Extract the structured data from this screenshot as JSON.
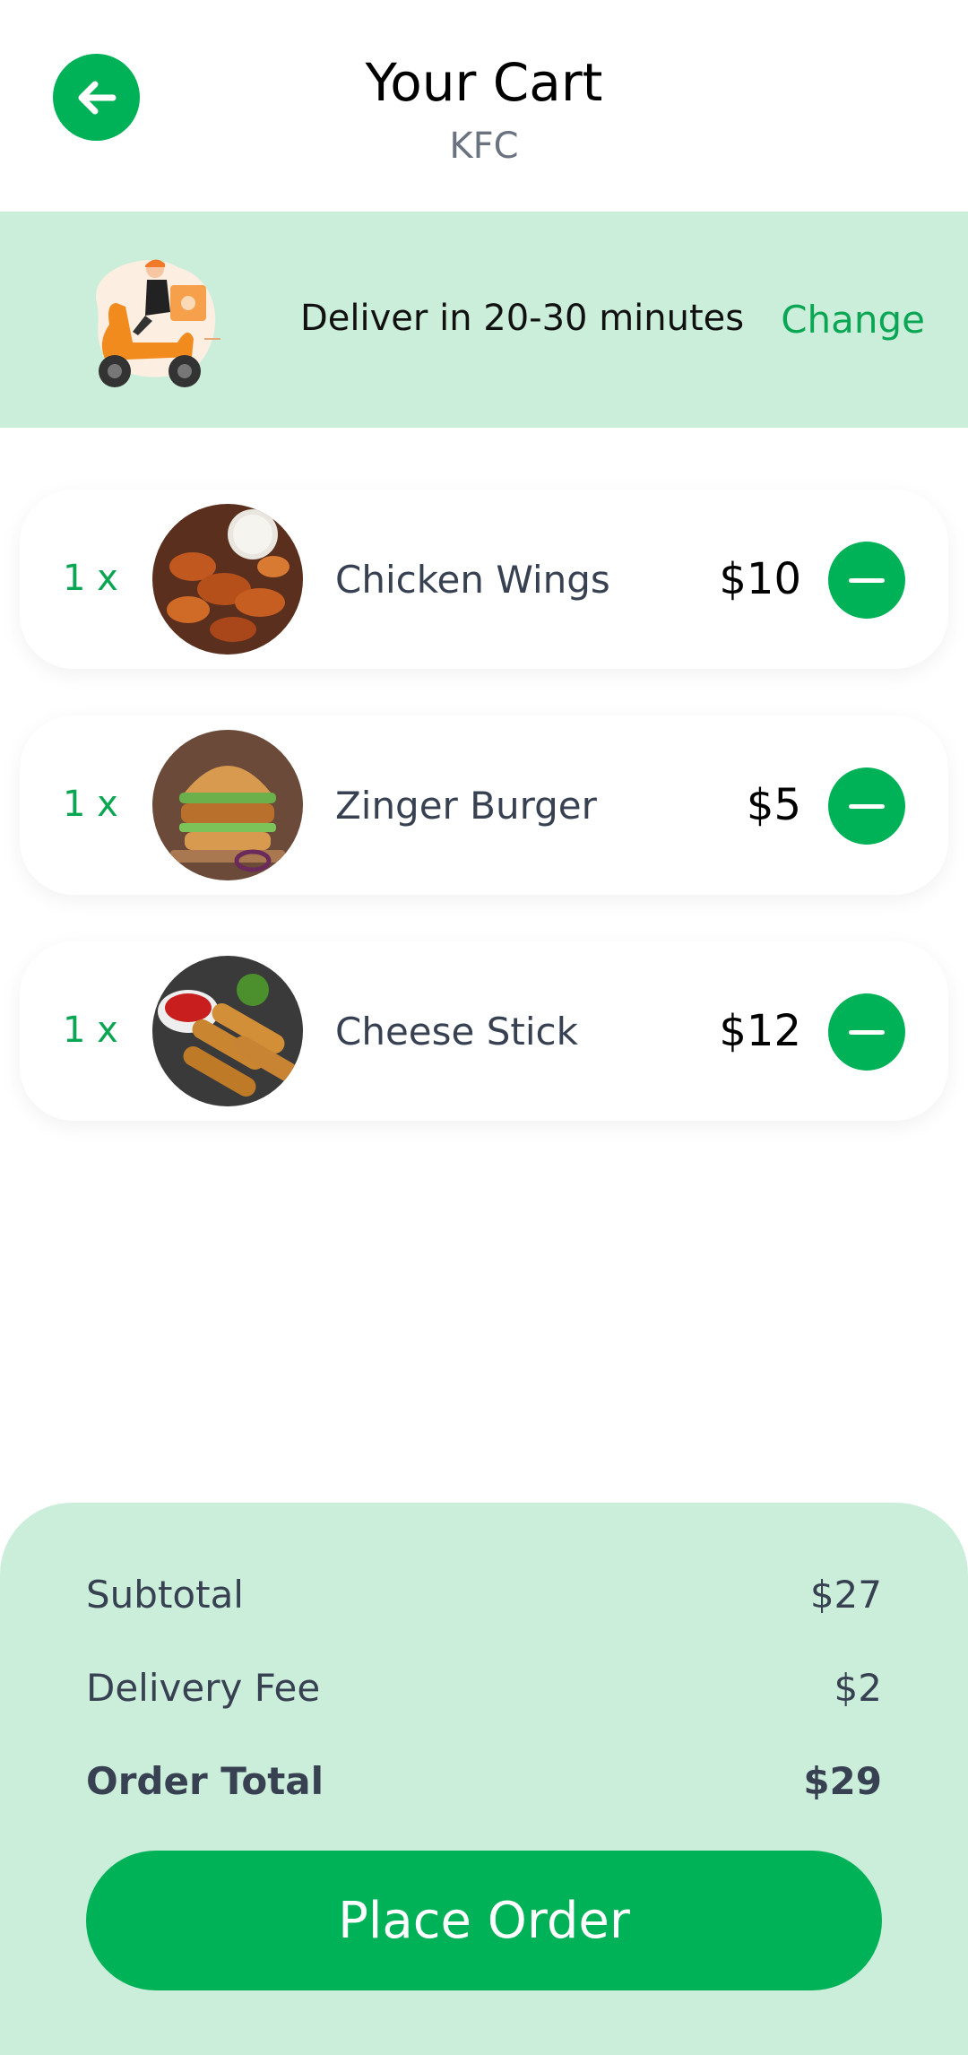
{
  "header": {
    "title": "Your Cart",
    "subtitle": "KFC"
  },
  "delivery": {
    "text": "Deliver in 20-30 minutes",
    "change_label": "Change"
  },
  "items": [
    {
      "qty": "1 x",
      "name": "Chicken Wings",
      "price": "$10",
      "image": "chicken-wings-photo"
    },
    {
      "qty": "1 x",
      "name": "Zinger Burger",
      "price": "$5",
      "image": "zinger-burger-photo"
    },
    {
      "qty": "1 x",
      "name": "Cheese Stick",
      "price": "$12",
      "image": "cheese-stick-photo"
    }
  ],
  "summary": {
    "subtotal_label": "Subtotal",
    "subtotal_value": "$27",
    "delivery_label": "Delivery Fee",
    "delivery_value": "$2",
    "total_label": "Order Total",
    "total_value": "$29",
    "place_order_label": "Place Order"
  },
  "colors": {
    "accent": "#00b257",
    "tint": "#cbeedb",
    "accent_text": "#0aa653"
  }
}
